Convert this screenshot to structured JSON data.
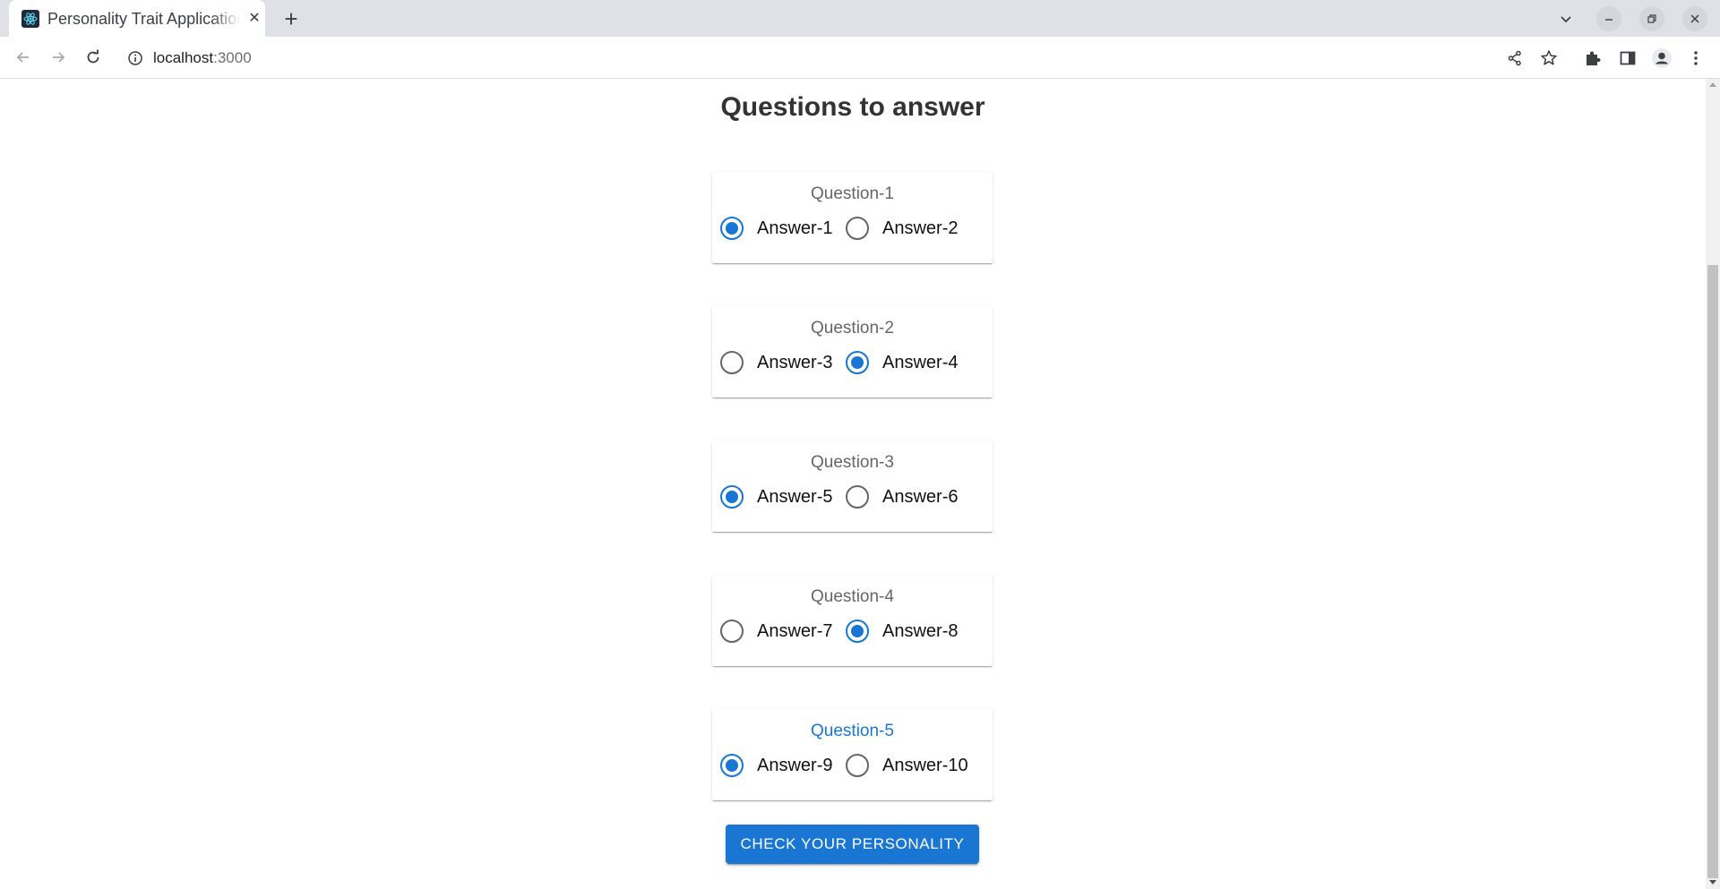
{
  "browser": {
    "tab_title": "Personality Trait Application",
    "tab_close": "✕",
    "new_tab": "+",
    "url_host": "localhost",
    "url_port": ":3000"
  },
  "page": {
    "heading": "Questions to answer",
    "questions": [
      {
        "label": "Question-1",
        "options": [
          {
            "label": "Answer-1",
            "checked": true
          },
          {
            "label": "Answer-2",
            "checked": false
          }
        ]
      },
      {
        "label": "Question-2",
        "options": [
          {
            "label": "Answer-3",
            "checked": false
          },
          {
            "label": "Answer-4",
            "checked": true
          }
        ]
      },
      {
        "label": "Question-3",
        "options": [
          {
            "label": "Answer-5",
            "checked": true
          },
          {
            "label": "Answer-6",
            "checked": false
          }
        ]
      },
      {
        "label": "Question-4",
        "options": [
          {
            "label": "Answer-7",
            "checked": false
          },
          {
            "label": "Answer-8",
            "checked": true
          }
        ]
      },
      {
        "label": "Question-5",
        "focused": true,
        "options": [
          {
            "label": "Answer-9",
            "checked": true
          },
          {
            "label": "Answer-10",
            "checked": false
          }
        ]
      }
    ],
    "submit_label": "CHECK YOUR PERSONALITY"
  },
  "colors": {
    "accent": "#1976d2",
    "question_label": "#666666",
    "heading": "#333333"
  },
  "icons": [
    "react-favicon-icon",
    "close-icon",
    "plus-icon",
    "chevron-down-icon",
    "minimize-icon",
    "restore-icon",
    "window-close-icon",
    "back-arrow-icon",
    "forward-arrow-icon",
    "reload-icon",
    "info-icon",
    "share-icon",
    "star-icon",
    "extensions-icon",
    "side-panel-icon",
    "profile-icon",
    "kebab-menu-icon"
  ]
}
